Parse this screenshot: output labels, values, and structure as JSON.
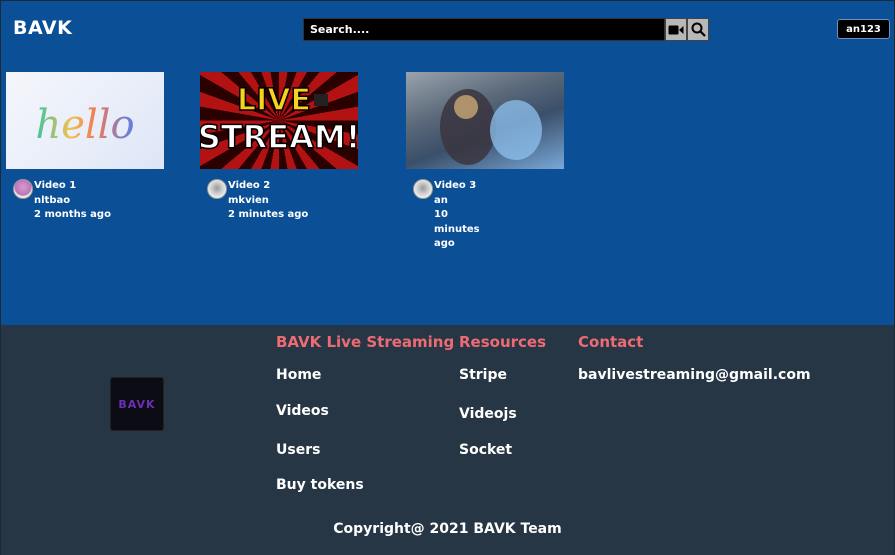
{
  "header": {
    "brand": "BAVK",
    "search_placeholder": "Search....",
    "video_icon": "video-camera-icon",
    "search_icon": "search-icon",
    "user_label": "an123"
  },
  "videos": [
    {
      "title": "Video 1",
      "author": "nltbao",
      "time": "2 months ago",
      "thumb": "hello"
    },
    {
      "title": "Video 2",
      "author": "mkvien",
      "time": "2 minutes ago",
      "thumb": "live-stream"
    },
    {
      "title": "Video 3",
      "author": "an",
      "time": "10 minutes ago",
      "thumb": "fantasy-art"
    }
  ],
  "thumb_text": {
    "hello": "hello",
    "live_line1": "LIVE",
    "live_line2": "STREAM!"
  },
  "footer": {
    "logo_text": "BAVK",
    "col1": {
      "heading": "BAVK Live Streaming",
      "links": [
        "Home",
        "Videos",
        "Users",
        "Buy tokens"
      ]
    },
    "col2": {
      "heading": "Resources",
      "links": [
        "Stripe",
        "Videojs",
        "Socket"
      ]
    },
    "col3": {
      "heading": "Contact",
      "email": "bavlivestreaming@gmail.com"
    },
    "copyright": "Copyright@ 2021 BAVK Team"
  },
  "colors": {
    "page_bg": "#0b4f96",
    "footer_bg": "#263645",
    "accent_heading": "#ef6b73"
  }
}
